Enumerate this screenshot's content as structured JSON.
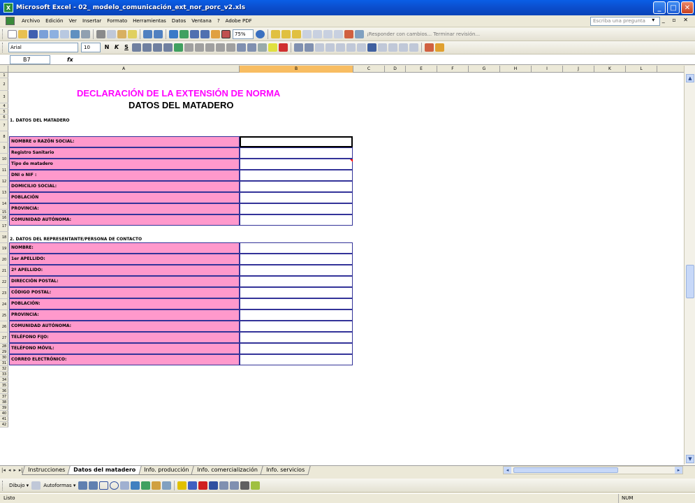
{
  "window": {
    "title": "Microsoft Excel - 02_ modelo_comunicación_ext_nor_porc_v2.xls"
  },
  "menu": {
    "items": [
      "Archivo",
      "Edición",
      "Ver",
      "Insertar",
      "Formato",
      "Herramientas",
      "Datos",
      "Ventana",
      "?",
      "Adobe PDF"
    ],
    "help_placeholder": "Escriba una pregunta"
  },
  "toolbar": {
    "zoom": "75%",
    "review_text": "¡Responder con cambios...  Terminar revisión..."
  },
  "format": {
    "font": "Arial",
    "size": "10"
  },
  "formula_bar": {
    "cell_ref": "B7",
    "fx": "fx",
    "content": ""
  },
  "columns": [
    "A",
    "B",
    "C",
    "D",
    "E",
    "F",
    "G",
    "H",
    "I",
    "J",
    "K",
    "L"
  ],
  "rows": [
    "1",
    "2",
    "3",
    "4",
    "5",
    "6",
    "7",
    "8",
    "9",
    "10",
    "11",
    "12",
    "13",
    "14",
    "15",
    "16",
    "17",
    "18",
    "19",
    "20",
    "21",
    "22",
    "23",
    "24",
    "25",
    "26",
    "27",
    "28",
    "29",
    "30",
    "31",
    "32",
    "33",
    "34",
    "35",
    "36",
    "37",
    "38",
    "39",
    "40",
    "41",
    "42"
  ],
  "sheet": {
    "title_main": "DECLARACIÓN DE LA EXTENSIÓN DE NORMA",
    "title_sub": "DATOS DEL MATADERO",
    "section1": "1. DATOS DEL MATADERO",
    "section1_fields": [
      "NOMBRE o RAZÓN SOCIAL:",
      "Registro Sanitario",
      "Tipo de matadero",
      "DNI o NIF :",
      "DOMICILIO SOCIAL:",
      "POBLACIÓN",
      "PROVINCIA:",
      "COMUNIDAD AUTÓNOMA:"
    ],
    "section2": "2. DATOS DEL REPRESENTANTE/PERSONA DE CONTACTO",
    "section2_fields": [
      "NOMBRE:",
      "1er APELLIDO:",
      "2º APELLIDO:",
      "DIRECCIÓN POSTAL:",
      "CÓDIGO POSTAL:",
      "POBLACIÓN:",
      "PROVINCIA:",
      "COMUNIDAD AUTÓNOMA:",
      "TELÉFONO FIJO:",
      "TELÉFONO MÓVIL:",
      "CORREO ELECTRÓNICO:"
    ]
  },
  "sheet_tabs": [
    "Instrucciones",
    "Datos del matadero",
    "Info. producción",
    "Info. comercialización",
    "Info. servicios"
  ],
  "active_tab": "Datos del matadero",
  "drawing": {
    "dibujo": "Dibujo ▾",
    "autoformas": "Autoformas ▾"
  },
  "status": {
    "left": "Listo",
    "num": "NUM"
  },
  "colors": {
    "label_fill": "#ff99cc",
    "border": "#333399",
    "title_magenta": "#ff00ff"
  }
}
